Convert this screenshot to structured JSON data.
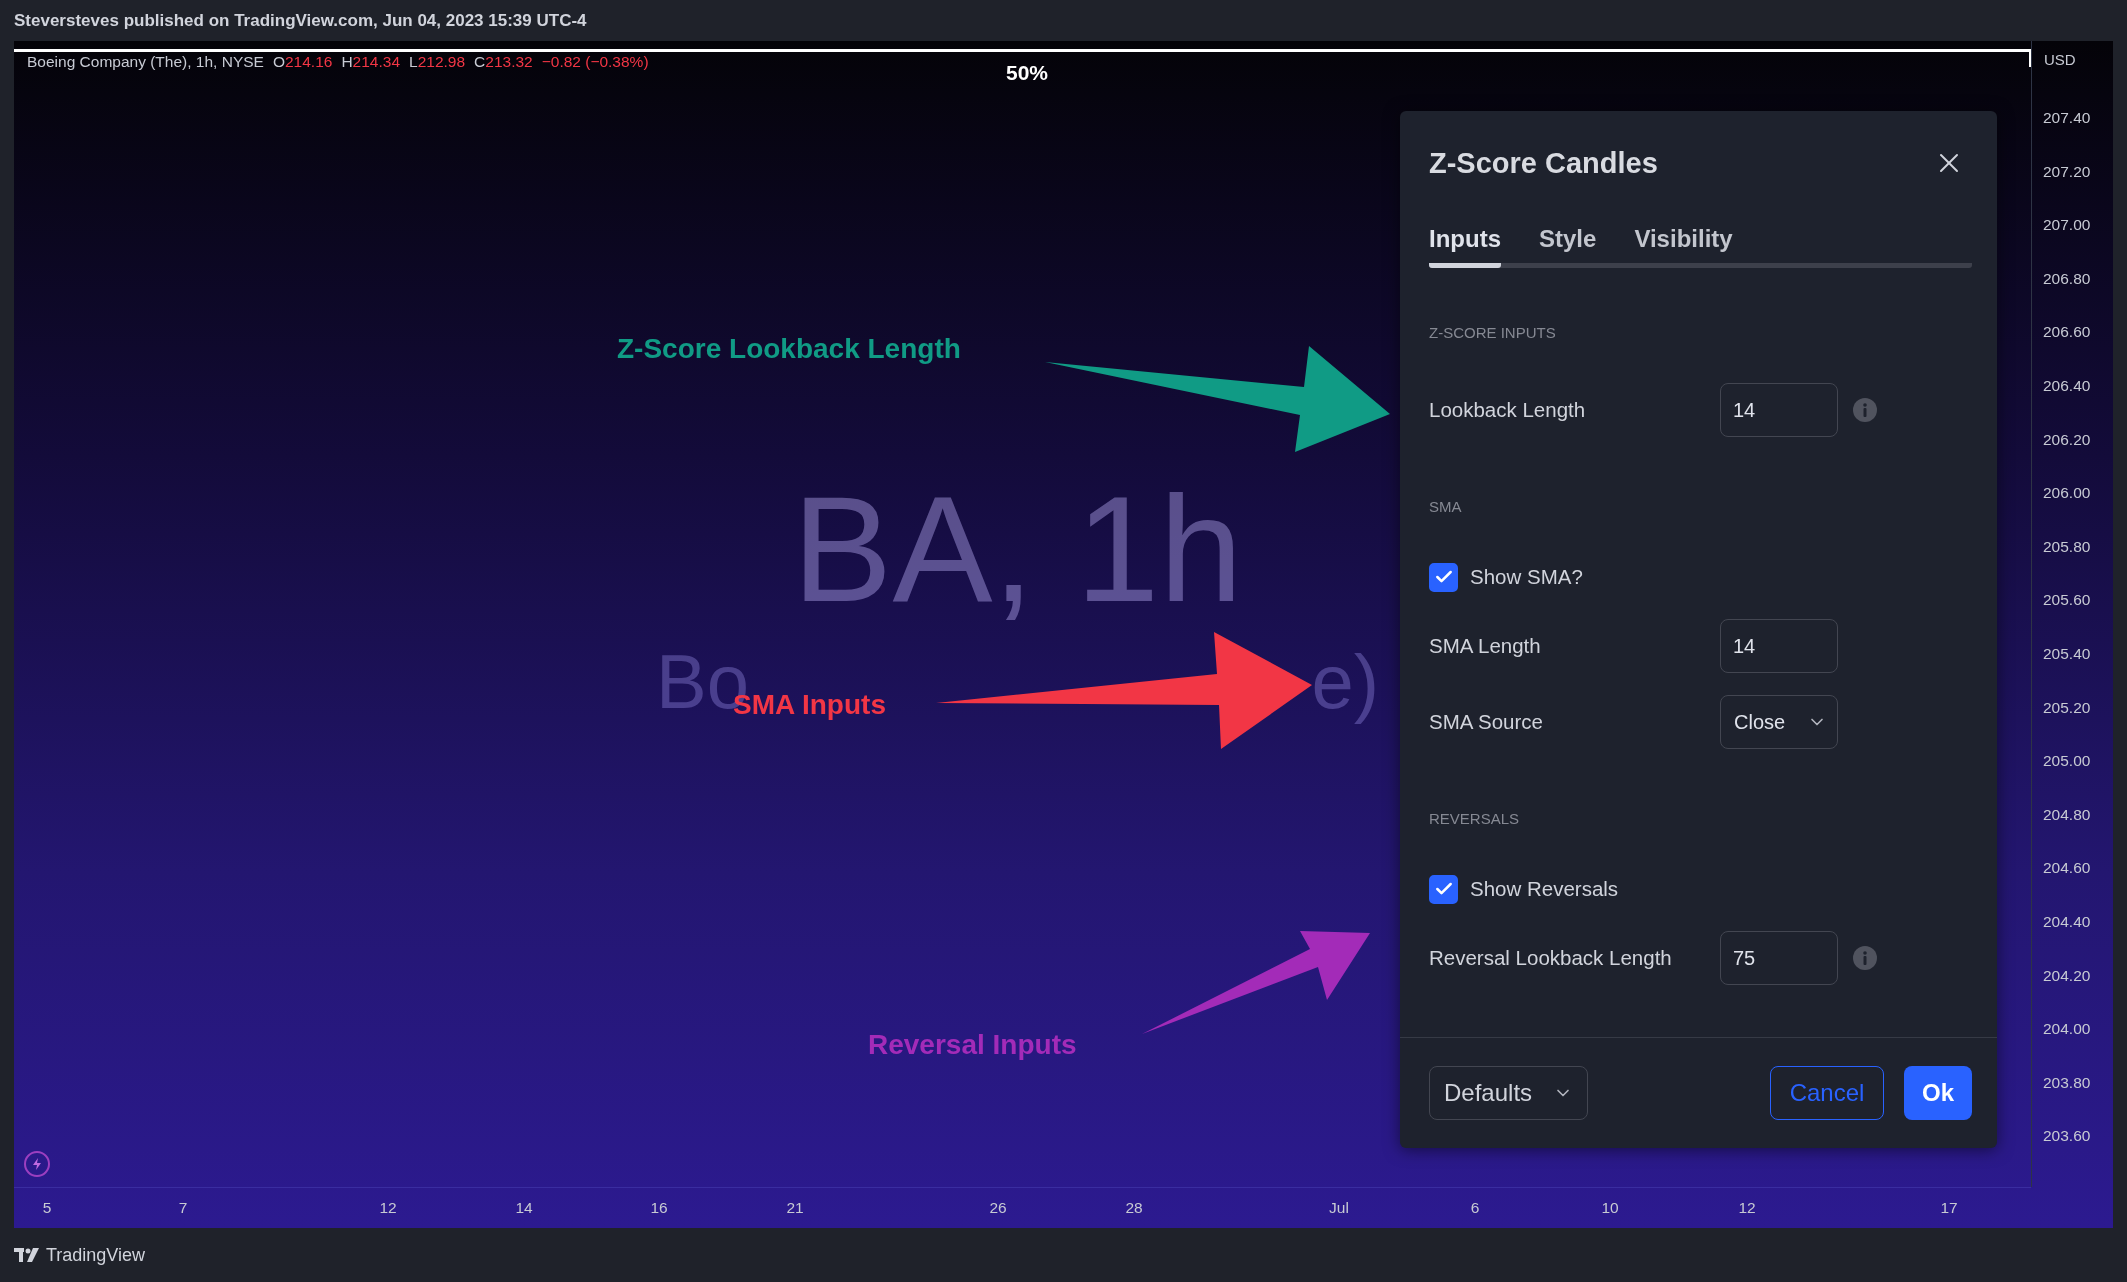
{
  "header": {
    "text": "Steversteves published on TradingView.com, Jun 04, 2023 15:39 UTC-4"
  },
  "chart": {
    "legend": {
      "symbol": "Boeing Company (The), 1h, NYSE",
      "values": [
        {
          "label": "O",
          "value": "214.16"
        },
        {
          "label": "H",
          "value": "214.34"
        },
        {
          "label": "L",
          "value": "212.98"
        },
        {
          "label": "C",
          "value": "213.32"
        }
      ],
      "change": "−0.82 (−0.38%)"
    },
    "percent_label": "50%",
    "watermark": {
      "title": "BA, 1h",
      "subtitle_parts": [
        "Bo",
        "e)"
      ]
    },
    "annotations": [
      {
        "text": "Z-Score Lookback Length",
        "color": "#109b85"
      },
      {
        "text": "SMA Inputs",
        "color": "#f23645"
      },
      {
        "text": "Reversal Inputs",
        "color": "#a32bb8"
      }
    ],
    "price_axis": {
      "currency": "USD",
      "labels": [
        "207.40",
        "207.20",
        "207.00",
        "206.80",
        "206.60",
        "206.40",
        "206.20",
        "206.00",
        "205.80",
        "205.60",
        "205.40",
        "205.20",
        "205.00",
        "204.80",
        "204.60",
        "204.40",
        "204.20",
        "204.00",
        "203.80",
        "203.60"
      ]
    },
    "time_axis": {
      "labels": [
        "5",
        "7",
        "12",
        "14",
        "16",
        "21",
        "26",
        "28",
        "Jul",
        "6",
        "10",
        "12",
        "17"
      ]
    }
  },
  "dialog": {
    "title": "Z-Score Candles",
    "tabs": [
      {
        "label": "Inputs",
        "selected": true
      },
      {
        "label": "Style",
        "selected": false
      },
      {
        "label": "Visibility",
        "selected": false
      }
    ],
    "sections": [
      {
        "heading": "Z-SCORE INPUTS",
        "rows": [
          {
            "kind": "input",
            "label": "Lookback Length",
            "value": "14",
            "info": true
          }
        ]
      },
      {
        "heading": "SMA",
        "rows": [
          {
            "kind": "checkbox",
            "label": "Show SMA?",
            "checked": true
          },
          {
            "kind": "input",
            "label": "SMA Length",
            "value": "14",
            "info": false
          },
          {
            "kind": "select",
            "label": "SMA Source",
            "value": "Close"
          }
        ]
      },
      {
        "heading": "REVERSALS",
        "rows": [
          {
            "kind": "checkbox",
            "label": "Show Reversals",
            "checked": true
          },
          {
            "kind": "input",
            "label": "Reversal Lookback Length",
            "value": "75",
            "info": true
          }
        ]
      }
    ],
    "footer": {
      "defaults": "Defaults",
      "cancel": "Cancel",
      "ok": "Ok"
    }
  },
  "footer": {
    "brand": "TradingView"
  }
}
